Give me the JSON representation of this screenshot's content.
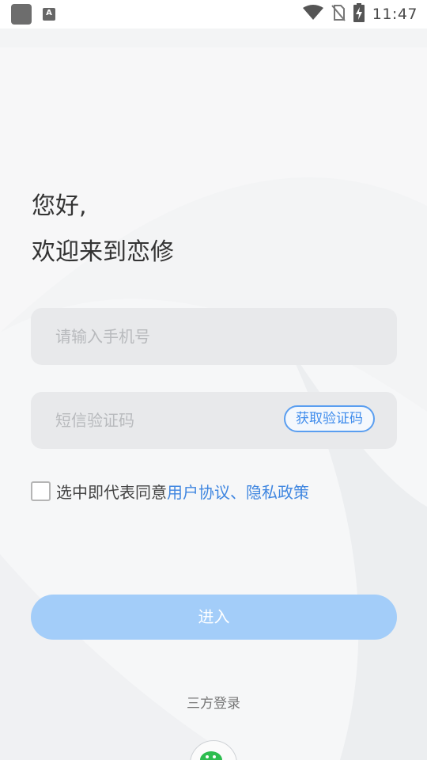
{
  "status_bar": {
    "time": "11:47",
    "icons": [
      "app-icon",
      "a-letter-icon",
      "wifi-icon",
      "no-sim-icon",
      "battery-charging-icon"
    ]
  },
  "greeting": {
    "line1": "您好,",
    "line2": "欢迎来到恋修"
  },
  "form": {
    "phone_placeholder": "请输入手机号",
    "code_placeholder": "短信验证码",
    "get_code_label": "获取验证码"
  },
  "agreement": {
    "checked": false,
    "prefix": "选中即代表同意",
    "links": "用户协议、隐私政策"
  },
  "enter_button": {
    "label": "进入"
  },
  "third_party": {
    "label": "三方登录",
    "icons": [
      "wechat-icon"
    ]
  },
  "colors": {
    "accent": "#3f86e0",
    "button_disabled": "#a3cdf9",
    "field_bg": "#e8e9eb"
  }
}
